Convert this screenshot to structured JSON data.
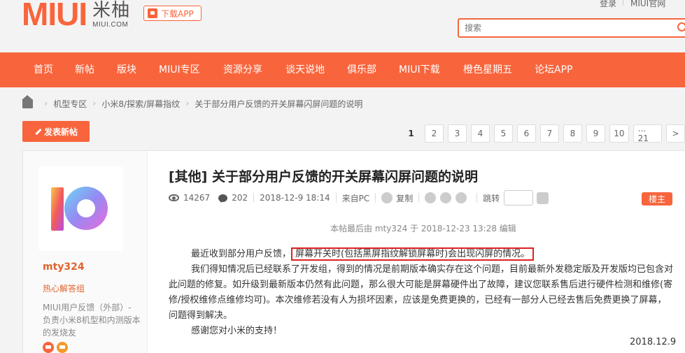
{
  "brand": {
    "logo_text": "MIUI",
    "logo_cn": "米柚",
    "logo_domain": "MIUI.COM",
    "accent": "#f8653c"
  },
  "header": {
    "download_label": "下载APP",
    "login_label": "登录",
    "site_link_label": "MIUI官网",
    "search_placeholder": "搜索"
  },
  "nav": {
    "items": [
      "首页",
      "新帖",
      "版块",
      "MIUI专区",
      "资源分享",
      "谈天说地",
      "俱乐部",
      "MIUI下载",
      "橙色星期五",
      "论坛APP"
    ]
  },
  "breadcrumb": [
    "机型专区",
    "小米8/探索/屏幕指纹",
    "关于部分用户反馈的开关屏幕闪屏问题的说明"
  ],
  "post_button_label": "发表新帖",
  "pagination": {
    "current": "1",
    "pages": [
      "2",
      "3",
      "4",
      "5",
      "6",
      "7",
      "8",
      "9",
      "10",
      "... 21",
      ">"
    ]
  },
  "author": {
    "name": "mty324",
    "group": "热心解答组",
    "description": "MIUI用户反馈（外部）- 负责小米8机型和内测版本的发烧友"
  },
  "post": {
    "title": "[其他] 关于部分用户反馈的开关屏幕闪屏问题的说明",
    "views": "14267",
    "replies": "202",
    "time": "2018-12-9 18:14",
    "source": "来自PC",
    "copy_label": "复制",
    "jump_label": "跳转",
    "floor_label": "楼主",
    "edited_note": "本帖最后由 mty324 于 2018-12-23 13:28 编辑",
    "paragraph1_start": "最近收到部分用户反馈，",
    "paragraph1_highlight": "屏幕开关时(包括黑屏指纹解锁屏幕时)会出现闪屏的情况。",
    "paragraph2": "我们得知情况后已经联系了开发组，得到的情况是前期版本确实存在这个问题，目前最新外发稳定版及开发版均已包含对此问题的修复。如升级到最新版本仍然有此问题，那么很大可能是屏幕硬件出了故障，建议您联系售后进行硬件检测和维修(寄修/授权维修点维修均可)。本次维修若没有人为损坏因素，应该是免费更换的，已经有一部分人已经去售后免费更换了屏幕，问题得到解决。",
    "paragraph3": "感谢您对小米的支持！",
    "date": "2018.12.9"
  }
}
